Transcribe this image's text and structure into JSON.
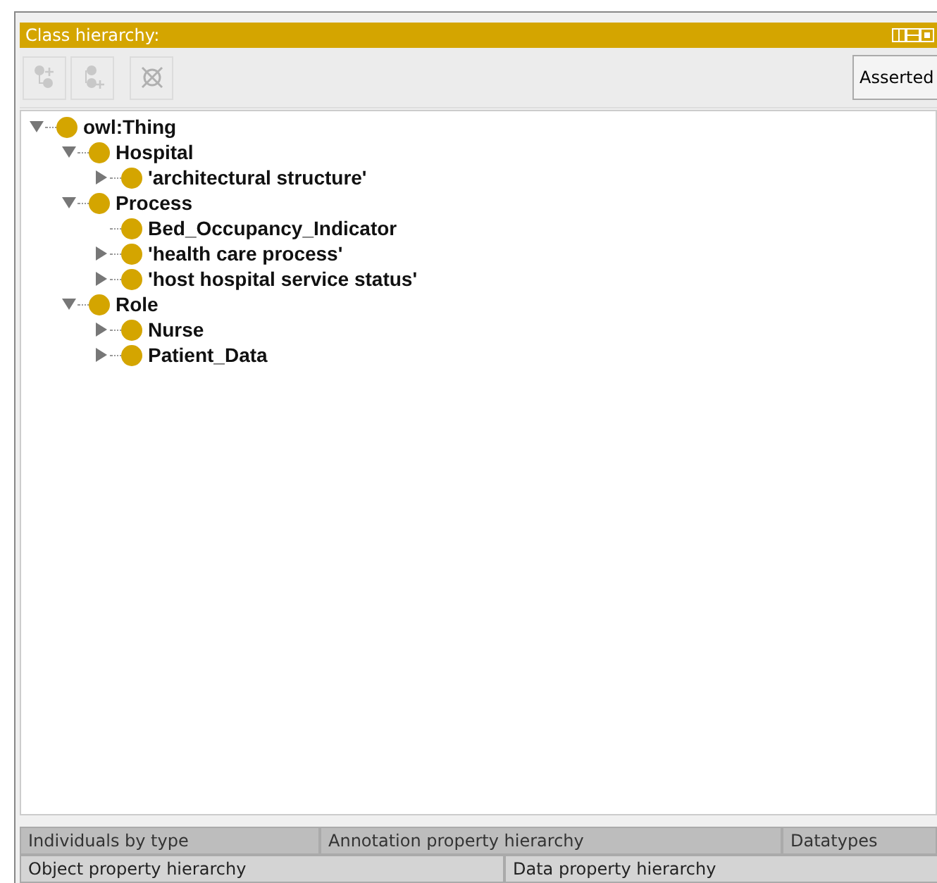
{
  "panel": {
    "title": "Class hierarchy:"
  },
  "toolbar": {
    "buttons": [
      {
        "kind": "add-subclass",
        "disabled": true
      },
      {
        "kind": "add-sibling",
        "disabled": true
      },
      {
        "kind": "delete",
        "disabled": true
      }
    ],
    "view_dropdown": {
      "value": "Asserted"
    }
  },
  "tree": [
    {
      "label": "owl:Thing",
      "kind": "branch",
      "expanded": true,
      "children": [
        {
          "label": "Hospital",
          "kind": "branch",
          "expanded": true,
          "children": [
            {
              "label": "'architectural structure'",
              "kind": "branch",
              "expanded": false
            }
          ]
        },
        {
          "label": "Process",
          "kind": "branch",
          "expanded": true,
          "children": [
            {
              "label": "Bed_Occupancy_Indicator",
              "kind": "leaf"
            },
            {
              "label": "'health care process'",
              "kind": "branch",
              "expanded": false
            },
            {
              "label": "'host hospital service status'",
              "kind": "branch",
              "expanded": false
            }
          ]
        },
        {
          "label": "Role",
          "kind": "branch",
          "expanded": true,
          "children": [
            {
              "label": "Nurse",
              "kind": "branch",
              "expanded": false
            },
            {
              "label": "Patient_Data",
              "kind": "branch",
              "expanded": false
            }
          ]
        }
      ]
    }
  ],
  "tab_rows": [
    [
      {
        "label": "Individuals by type",
        "selected": false
      },
      {
        "label": "Annotation property hierarchy",
        "selected": false
      },
      {
        "label": "Datatypes",
        "selected": false
      }
    ],
    [
      {
        "label": "Object property hierarchy",
        "selected": false
      },
      {
        "label": "Data property hierarchy",
        "selected": false
      }
    ]
  ]
}
